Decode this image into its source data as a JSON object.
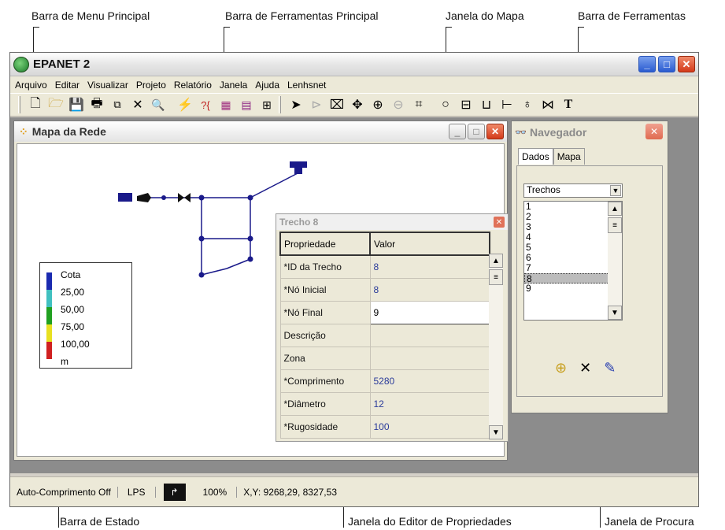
{
  "annotations": {
    "main_menu": "Barra de Menu Principal",
    "main_toolbar": "Barra de Ferramentas Principal",
    "map_window": "Janela do Mapa",
    "toolbar": "Barra de Ferramentas",
    "status_bar": "Barra de Estado",
    "property_editor": "Janela do Editor de Propriedades",
    "browser": "Janela de Procura"
  },
  "app": {
    "title": "EPANET 2",
    "menu": [
      "Arquivo",
      "Editar",
      "Visualizar",
      "Projeto",
      "Relatório",
      "Janela",
      "Ajuda",
      "Lenhsnet"
    ]
  },
  "toolbar_icons": [
    "new-file-icon",
    "open-folder-icon",
    "save-icon",
    "print-icon",
    "copy-icon",
    "delete-icon",
    "find-icon",
    "run-icon",
    "query-icon",
    "graph-icon",
    "table-icon",
    "options-icon",
    "select-arrow-icon",
    "select-vertex-icon",
    "select-region-icon",
    "pan-icon",
    "zoom-in-icon",
    "zoom-out-icon",
    "full-extent-icon",
    "junction-icon",
    "reservoir-icon",
    "tank-icon",
    "pipe-icon",
    "pump-icon",
    "valve-icon",
    "label-icon"
  ],
  "map": {
    "title": "Mapa da Rede",
    "legend": {
      "title": "Cota",
      "values": [
        "25,00",
        "50,00",
        "75,00",
        "100,00"
      ],
      "unit": "m",
      "colors": [
        "#1a2ab0",
        "#40c0c0",
        "#20a020",
        "#e8e020",
        "#d02020"
      ]
    }
  },
  "property_editor": {
    "title": "Trecho 8",
    "header": {
      "key": "Propriedade",
      "value": "Valor"
    },
    "rows": [
      {
        "key": "*ID da Trecho",
        "value": "8"
      },
      {
        "key": "*Nó Inicial",
        "value": "8"
      },
      {
        "key": "*Nó Final",
        "value": "9"
      },
      {
        "key": "Descrição",
        "value": ""
      },
      {
        "key": "Zona",
        "value": ""
      },
      {
        "key": "*Comprimento",
        "value": "5280"
      },
      {
        "key": "*Diâmetro",
        "value": "12"
      },
      {
        "key": "*Rugosidade",
        "value": "100"
      }
    ]
  },
  "browser": {
    "title": "Navegador",
    "tabs": [
      "Dados",
      "Mapa"
    ],
    "category": "Trechos",
    "items": [
      "1",
      "2",
      "3",
      "4",
      "5",
      "6",
      "7",
      "8",
      "9"
    ],
    "selected": "8"
  },
  "status": {
    "auto_length": "Auto-Comprimento Off",
    "flow_units": "LPS",
    "zoom": "100%",
    "coords": "X,Y: 9268,29, 8327,53"
  }
}
